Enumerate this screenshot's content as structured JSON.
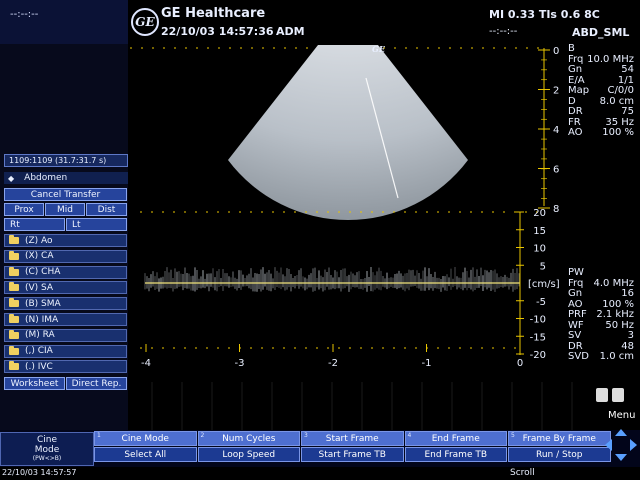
{
  "header": {
    "left_date": "--:--:--",
    "brand": "GE Healthcare",
    "logo_text": "GE",
    "datetime": "22/10/03 14:57:36",
    "operator": "ADM",
    "mi_tis": "MI 0.33  TIs 0.6  8C",
    "right_dashes": "--:--:--",
    "preset": "ABD_SML"
  },
  "left_panel": {
    "time": "1109:1109     (31.7:31.7 s)",
    "exam": "Abdomen",
    "cancel_transfer": "Cancel Transfer",
    "prox": "Prox",
    "mid": "Mid",
    "dist": "Dist",
    "rt": "Rt",
    "lt": "Lt",
    "vessels": [
      "(Z)  Ao",
      "(X)  CA",
      "(C)  CHA",
      "(V)  SA",
      "(B)  SMA",
      "(N)  IMA",
      "(M)  RA",
      "(,)  CIA",
      "(.)  IVC"
    ],
    "worksheet": "Worksheet",
    "direct_rep": "Direct Rep."
  },
  "bmode_params": {
    "mode": "B",
    "rows": [
      {
        "k": "Frq",
        "v": "10.0 MHz"
      },
      {
        "k": "Gn",
        "v": "54"
      },
      {
        "k": "E/A",
        "v": "1/1"
      },
      {
        "k": "Map",
        "v": "C/0/0"
      },
      {
        "k": "D",
        "v": "8.0 cm"
      },
      {
        "k": "DR",
        "v": "75"
      },
      {
        "k": "FR",
        "v": "35 Hz"
      },
      {
        "k": "AO",
        "v": "100 %"
      }
    ]
  },
  "pw_params": {
    "mode": "PW",
    "rows": [
      {
        "k": "Frq",
        "v": "4.0 MHz"
      },
      {
        "k": "Gn",
        "v": "16"
      },
      {
        "k": "AO",
        "v": "100 %"
      },
      {
        "k": "PRF",
        "v": "2.1 kHz"
      },
      {
        "k": "WF",
        "v": "50 Hz"
      },
      {
        "k": "SV",
        "v": "3"
      },
      {
        "k": "DR",
        "v": "48"
      },
      {
        "k": "SVD",
        "v": "1.0 cm"
      }
    ]
  },
  "depth_scale": {
    "ticks": [
      "0",
      "2",
      "4",
      "6",
      "8"
    ],
    "unit": "8"
  },
  "velocity_axis": {
    "unit": "[cm/s]",
    "ticks": [
      "20",
      "15",
      "10",
      "5",
      "-5",
      "-10",
      "-15",
      "-20"
    ]
  },
  "time_axis": {
    "ticks": [
      "-4",
      "-3",
      "-2",
      "-1",
      "0"
    ]
  },
  "softkeys": {
    "cine_mode_line1": "Cine",
    "cine_mode_line2": "Mode",
    "cine_mode_line3": "(PW<>B)",
    "top": [
      {
        "num": "1",
        "label": "Cine Mode"
      },
      {
        "num": "2",
        "label": "Num Cycles"
      },
      {
        "num": "3",
        "label": "Start Frame"
      },
      {
        "num": "4",
        "label": "End Frame"
      },
      {
        "num": "5",
        "label": "Frame By Frame"
      }
    ],
    "bottom": [
      {
        "label": "Select All"
      },
      {
        "label": "Loop Speed"
      },
      {
        "label": "Start Frame TB"
      },
      {
        "label": "End Frame TB"
      },
      {
        "label": "Run / Stop"
      }
    ]
  },
  "footer": {
    "datetime": "22/10/03 14:57:57",
    "scroll": "Scroll",
    "menu": "Menu"
  }
}
